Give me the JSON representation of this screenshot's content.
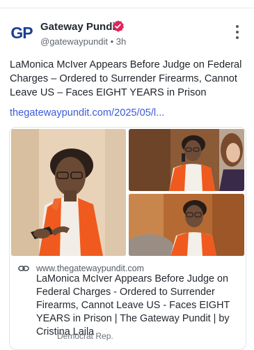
{
  "post": {
    "author_name": "Gateway Pundit",
    "handle_time": "@gatewaypundit • 3h",
    "avatar_text": "GP",
    "text": "LaMonica McIver Appears Before Judge on Federal Charges – Ordered to Surrender Firearms, Cannot Leave US – Faces EIGHT YEARS in Prison",
    "link_text": "thegatewaypundit.com/2025/05/l..."
  },
  "card": {
    "domain": "www.thegatewaypundit.com",
    "title": "LaMonica McIver Appears Before Judge on Federal Charges - Ordered to Surrender Firearms, Cannot Leave US - Faces EIGHT YEARS in Prison | The Gateway Pundit | by Cristina Laila",
    "caption": "Democrat Rep."
  },
  "colors": {
    "link": "#3d5bd6",
    "verified_badge": "#e0245e",
    "brand_blue": "#1b3f95",
    "vest_orange": "#f05a1e"
  },
  "icons": {
    "verified": "verified-badge-icon",
    "more": "more-vertical-icon",
    "link": "link-chain-icon"
  }
}
